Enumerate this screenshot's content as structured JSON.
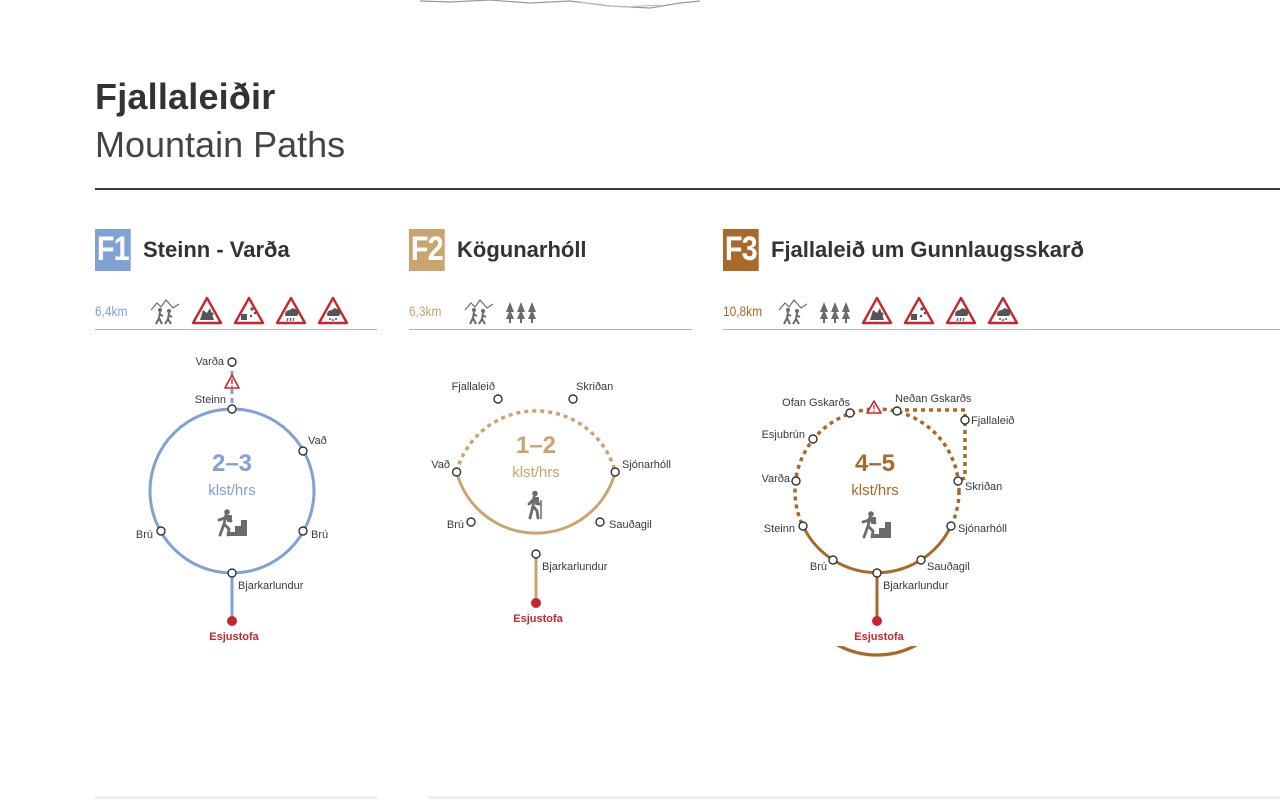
{
  "header": {
    "title": "Fjallaleiðir",
    "subtitle": "Mountain Paths"
  },
  "routes": [
    {
      "code": "F1",
      "name": "Steinn - Varða",
      "distance": "6,4km",
      "color": "#7fa1d4",
      "duration": "2–3",
      "duration_unit": "klst/hrs",
      "icons": [
        "hikers-icon",
        "steep-cliff-warning-icon",
        "rockfall-warning-icon",
        "rain-warning-icon",
        "snow-warning-icon"
      ],
      "stops": {
        "top": "Varða",
        "steinn": "Steinn",
        "vad": "Vað",
        "bru_left": "Brú",
        "bru_right": "Brú",
        "bjarkarlundur": "Bjarkarlundur",
        "esjustofa": "Esjustofa"
      }
    },
    {
      "code": "F2",
      "name": "Kögunarhóll",
      "distance": "6,3km",
      "color": "#c9a46e",
      "duration": "1–2",
      "duration_unit": "klst/hrs",
      "icons": [
        "hikers-icon",
        "forest-icon"
      ],
      "stops": {
        "fjallaleid": "Fjallaleið",
        "skridan": "Skriðan",
        "vad": "Vað",
        "sjonarholl": "Sjónarhóll",
        "bru": "Brú",
        "saudagil": "Sauðagil",
        "bjarkarlundur": "Bjarkarlundur",
        "esjustofa": "Esjustofa"
      }
    },
    {
      "code": "F3",
      "name": "Fjallaleið um Gunnlaugsskarð",
      "distance": "10,8km",
      "color": "#a8692a",
      "duration": "4–5",
      "duration_unit": "klst/hrs",
      "icons": [
        "hikers-icon",
        "forest-icon",
        "steep-cliff-warning-icon",
        "rockfall-warning-icon",
        "rain-warning-icon",
        "snow-warning-icon"
      ],
      "stops": {
        "ofan": "Ofan Gskarðs",
        "nedan": "Neðan Gskarðs",
        "fjallaleid": "Fjallaleið",
        "esjubrun": "Esjubrún",
        "varda": "Varða",
        "skridan": "Skriðan",
        "steinn": "Steinn",
        "sjonarholl": "Sjónarhóll",
        "bru": "Brú",
        "saudagil": "Sauðagil",
        "bjarkarlundur": "Bjarkarlundur",
        "esjustofa": "Esjustofa"
      }
    }
  ],
  "colors": {
    "accent_red": "#c8262d",
    "text": "#3a3a3a",
    "icon_gray": "#6b6b6b"
  }
}
